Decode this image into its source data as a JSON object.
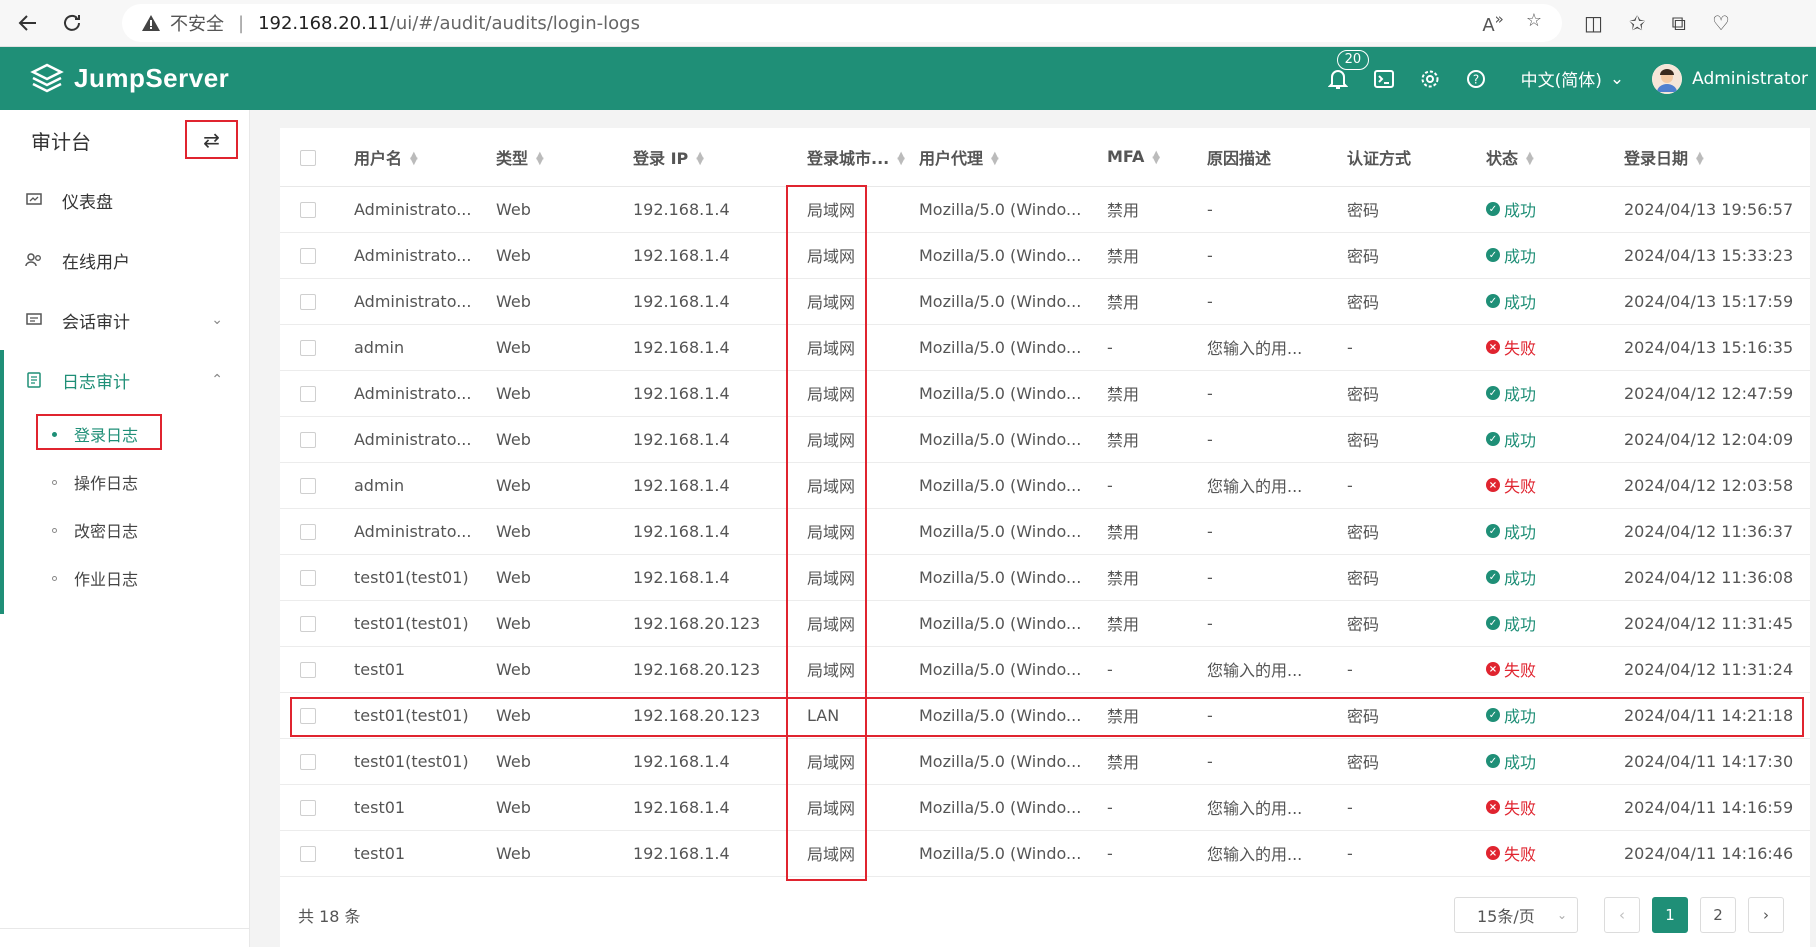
{
  "browser": {
    "insecure_label": "不安全",
    "url_host": "192.168.20.11",
    "url_path": "/ui/#/audit/audits/login-logs"
  },
  "header": {
    "brand": "JumpServer",
    "notification_count": "20",
    "language": "中文(简体)",
    "username": "Administrator",
    "accent_color": "#1f8f77"
  },
  "sidebar": {
    "title": "审计台",
    "items": [
      {
        "label": "仪表盘",
        "icon": "dashboard-icon"
      },
      {
        "label": "在线用户",
        "icon": "users-icon"
      },
      {
        "label": "会话审计",
        "icon": "session-icon"
      },
      {
        "label": "日志审计",
        "icon": "log-icon"
      }
    ],
    "sub_items": [
      {
        "label": "登录日志",
        "active": true
      },
      {
        "label": "操作日志"
      },
      {
        "label": "改密日志"
      },
      {
        "label": "作业日志"
      }
    ]
  },
  "table": {
    "columns": [
      "用户名",
      "类型",
      "登录 IP",
      "登录城市...",
      "用户代理",
      "MFA",
      "原因描述",
      "认证方式",
      "状态",
      "登录日期"
    ],
    "rows": [
      {
        "user": "Administrato...",
        "type": "Web",
        "ip": "192.168.1.4",
        "city": "局域网",
        "agent": "Mozilla/5.0 (Windo...",
        "mfa": "禁用",
        "reason": "-",
        "auth": "密码",
        "status": "成功",
        "ok": true,
        "date": "2024/04/13 19:56:57"
      },
      {
        "user": "Administrato...",
        "type": "Web",
        "ip": "192.168.1.4",
        "city": "局域网",
        "agent": "Mozilla/5.0 (Windo...",
        "mfa": "禁用",
        "reason": "-",
        "auth": "密码",
        "status": "成功",
        "ok": true,
        "date": "2024/04/13 15:33:23"
      },
      {
        "user": "Administrato...",
        "type": "Web",
        "ip": "192.168.1.4",
        "city": "局域网",
        "agent": "Mozilla/5.0 (Windo...",
        "mfa": "禁用",
        "reason": "-",
        "auth": "密码",
        "status": "成功",
        "ok": true,
        "date": "2024/04/13 15:17:59"
      },
      {
        "user": "admin",
        "type": "Web",
        "ip": "192.168.1.4",
        "city": "局域网",
        "agent": "Mozilla/5.0 (Windo...",
        "mfa": "-",
        "reason": "您输入的用...",
        "auth": "-",
        "status": "失败",
        "ok": false,
        "date": "2024/04/13 15:16:35"
      },
      {
        "user": "Administrato...",
        "type": "Web",
        "ip": "192.168.1.4",
        "city": "局域网",
        "agent": "Mozilla/5.0 (Windo...",
        "mfa": "禁用",
        "reason": "-",
        "auth": "密码",
        "status": "成功",
        "ok": true,
        "date": "2024/04/12 12:47:59"
      },
      {
        "user": "Administrato...",
        "type": "Web",
        "ip": "192.168.1.4",
        "city": "局域网",
        "agent": "Mozilla/5.0 (Windo...",
        "mfa": "禁用",
        "reason": "-",
        "auth": "密码",
        "status": "成功",
        "ok": true,
        "date": "2024/04/12 12:04:09"
      },
      {
        "user": "admin",
        "type": "Web",
        "ip": "192.168.1.4",
        "city": "局域网",
        "agent": "Mozilla/5.0 (Windo...",
        "mfa": "-",
        "reason": "您输入的用...",
        "auth": "-",
        "status": "失败",
        "ok": false,
        "date": "2024/04/12 12:03:58"
      },
      {
        "user": "Administrato...",
        "type": "Web",
        "ip": "192.168.1.4",
        "city": "局域网",
        "agent": "Mozilla/5.0 (Windo...",
        "mfa": "禁用",
        "reason": "-",
        "auth": "密码",
        "status": "成功",
        "ok": true,
        "date": "2024/04/12 11:36:37"
      },
      {
        "user": "test01(test01)",
        "type": "Web",
        "ip": "192.168.1.4",
        "city": "局域网",
        "agent": "Mozilla/5.0 (Windo...",
        "mfa": "禁用",
        "reason": "-",
        "auth": "密码",
        "status": "成功",
        "ok": true,
        "date": "2024/04/12 11:36:08"
      },
      {
        "user": "test01(test01)",
        "type": "Web",
        "ip": "192.168.20.123",
        "city": "局域网",
        "agent": "Mozilla/5.0 (Windo...",
        "mfa": "禁用",
        "reason": "-",
        "auth": "密码",
        "status": "成功",
        "ok": true,
        "date": "2024/04/12 11:31:45"
      },
      {
        "user": "test01",
        "type": "Web",
        "ip": "192.168.20.123",
        "city": "局域网",
        "agent": "Mozilla/5.0 (Windo...",
        "mfa": "-",
        "reason": "您输入的用...",
        "auth": "-",
        "status": "失败",
        "ok": false,
        "date": "2024/04/12 11:31:24"
      },
      {
        "user": "test01(test01)",
        "type": "Web",
        "ip": "192.168.20.123",
        "city": "LAN",
        "agent": "Mozilla/5.0 (Windo...",
        "mfa": "禁用",
        "reason": "-",
        "auth": "密码",
        "status": "成功",
        "ok": true,
        "date": "2024/04/11 14:21:18"
      },
      {
        "user": "test01(test01)",
        "type": "Web",
        "ip": "192.168.1.4",
        "city": "局域网",
        "agent": "Mozilla/5.0 (Windo...",
        "mfa": "禁用",
        "reason": "-",
        "auth": "密码",
        "status": "成功",
        "ok": true,
        "date": "2024/04/11 14:17:30"
      },
      {
        "user": "test01",
        "type": "Web",
        "ip": "192.168.1.4",
        "city": "局域网",
        "agent": "Mozilla/5.0 (Windo...",
        "mfa": "-",
        "reason": "您输入的用...",
        "auth": "-",
        "status": "失败",
        "ok": false,
        "date": "2024/04/11 14:16:59"
      },
      {
        "user": "test01",
        "type": "Web",
        "ip": "192.168.1.4",
        "city": "局域网",
        "agent": "Mozilla/5.0 (Windo...",
        "mfa": "-",
        "reason": "您输入的用...",
        "auth": "-",
        "status": "失败",
        "ok": false,
        "date": "2024/04/11 14:16:46"
      }
    ]
  },
  "pagination": {
    "total": "共 18 条",
    "page_size": "15条/页",
    "pages": [
      "1",
      "2"
    ],
    "current": "1"
  }
}
